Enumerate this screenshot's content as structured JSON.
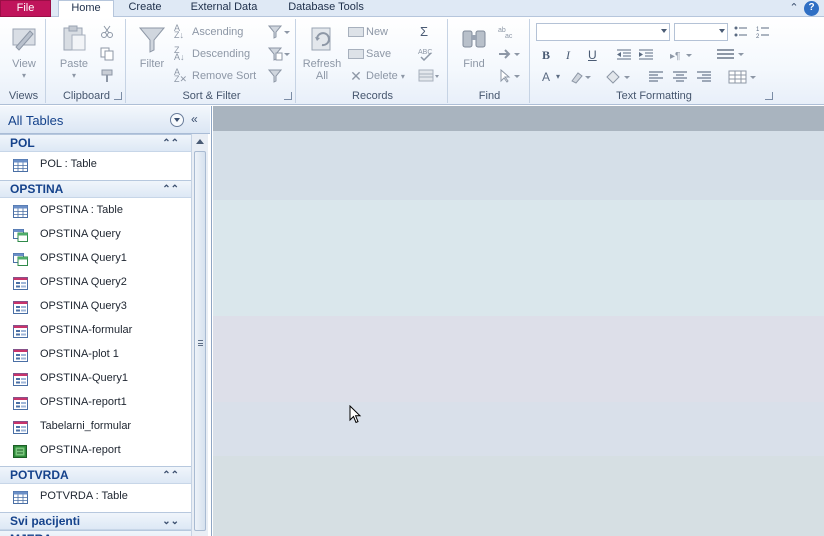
{
  "tabs": {
    "file": "File",
    "home": "Home",
    "create": "Create",
    "external": "External Data",
    "database": "Database Tools"
  },
  "ribbon": {
    "views": {
      "view_label": "View",
      "group_label": "Views"
    },
    "clipboard": {
      "paste_label": "Paste",
      "group_label": "Clipboard"
    },
    "sort_filter": {
      "filter_label": "Filter",
      "ascending": "Ascending",
      "descending": "Descending",
      "remove_sort": "Remove Sort",
      "group_label": "Sort & Filter"
    },
    "records": {
      "refresh_label": "Refresh",
      "refresh_sub": "All",
      "new_label": "New",
      "save_label": "Save",
      "delete_label": "Delete",
      "totals_glyph": "Σ",
      "group_label": "Records"
    },
    "find": {
      "find_label": "Find",
      "group_label": "Find"
    },
    "text_formatting": {
      "bold": "B",
      "italic": "I",
      "underline": "U",
      "font_color": "A",
      "group_label": "Text Formatting"
    }
  },
  "nav": {
    "title": "All Tables",
    "collapse_glyph": "«",
    "groups": [
      {
        "name": "POL",
        "chevron": "⌃⌃",
        "items": [
          {
            "label": "POL : Table",
            "icon": "table-icon"
          }
        ]
      },
      {
        "name": "OPSTINA",
        "chevron": "⌃⌃",
        "items": [
          {
            "label": "OPSTINA : Table",
            "icon": "table-icon"
          },
          {
            "label": "OPSTINA Query",
            "icon": "query-icon"
          },
          {
            "label": "OPSTINA Query1",
            "icon": "query-icon"
          },
          {
            "label": "OPSTINA Query2",
            "icon": "form-icon"
          },
          {
            "label": "OPSTINA Query3",
            "icon": "form-icon"
          },
          {
            "label": "OPSTINA-formular",
            "icon": "form-icon"
          },
          {
            "label": "OPSTINA-plot 1",
            "icon": "form-icon"
          },
          {
            "label": "OPSTINA-Query1",
            "icon": "form-icon"
          },
          {
            "label": "OPSTINA-report1",
            "icon": "form-icon"
          },
          {
            "label": "Tabelarni_formular",
            "icon": "form-icon"
          },
          {
            "label": "OPSTINA-report",
            "icon": "report-icon"
          }
        ]
      },
      {
        "name": "POTVRDA",
        "chevron": "⌃⌃",
        "items": [
          {
            "label": "POTVRDA : Table",
            "icon": "table-icon"
          }
        ]
      },
      {
        "name": "Svi pacijenti",
        "chevron": "⌄⌄",
        "items": []
      },
      {
        "name": "MJERA",
        "chevron": "⌄⌄",
        "items": []
      }
    ]
  },
  "colors": {
    "file_tab": "#c0145b",
    "nav_header_text": "#15428b",
    "work_bands": [
      "#a9b4bf",
      "#d5dfe8",
      "#dae7ec",
      "#dddfe9",
      "#d9e0ea",
      "#d6dfe3"
    ]
  }
}
